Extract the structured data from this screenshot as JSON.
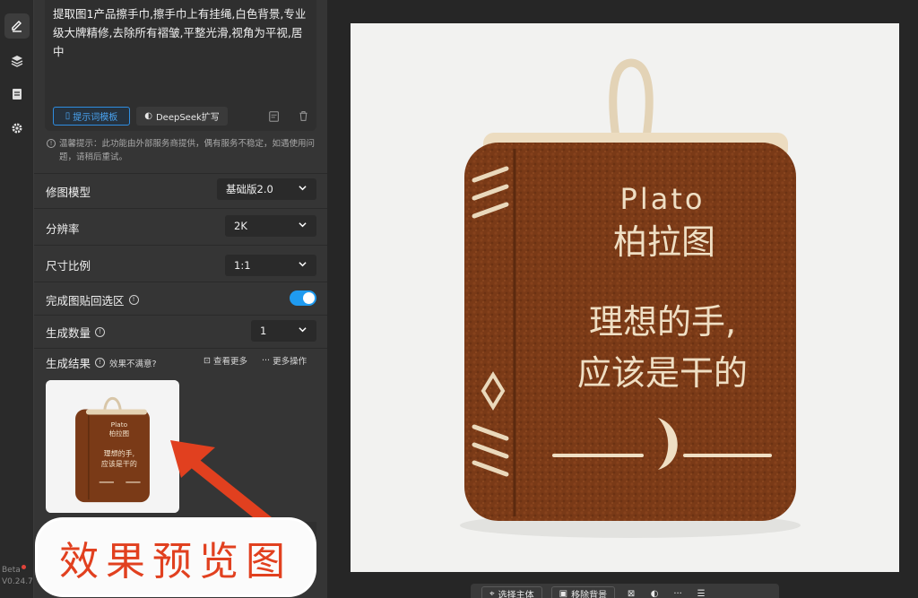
{
  "version": {
    "beta": "Beta",
    "number": "V0.24.7"
  },
  "prompt": {
    "text": "提取图1产品擦手巾,擦手巾上有挂绳,白色背景,专业级大牌精修,去除所有褶皱,平整光滑,视角为平视,居中",
    "template_button": "提示词模板",
    "deepseek_button": "DeepSeek扩写"
  },
  "tip": "温馨提示：此功能由外部服务商提供，偶有服务不稳定，如遇使用问题，请稍后重试。",
  "settings": {
    "model": {
      "label": "修图模型",
      "value": "基础版2.0"
    },
    "resolution": {
      "label": "分辨率",
      "value": "2K"
    },
    "ratio": {
      "label": "尺寸比例",
      "value": "1:1"
    },
    "paste_back": {
      "label": "完成图贴回选区",
      "enabled": true
    },
    "count": {
      "label": "生成数量",
      "value": "1"
    }
  },
  "result": {
    "label": "生成结果",
    "not_satisfied": "效果不满意?",
    "view_more": "查看更多",
    "more_actions": "更多操作"
  },
  "product": {
    "en_name": "Plato",
    "cn_name": "柏拉图",
    "line1": "理想的手,",
    "line2": "应该是干的"
  },
  "toolbar": {
    "select_subject": "选择主体",
    "remove_bg": "移除背景"
  },
  "annotation": "效果预览图",
  "colors": {
    "accent": "#1f9bf0",
    "annotation": "#e1401f",
    "towel": "#7a3a17"
  }
}
